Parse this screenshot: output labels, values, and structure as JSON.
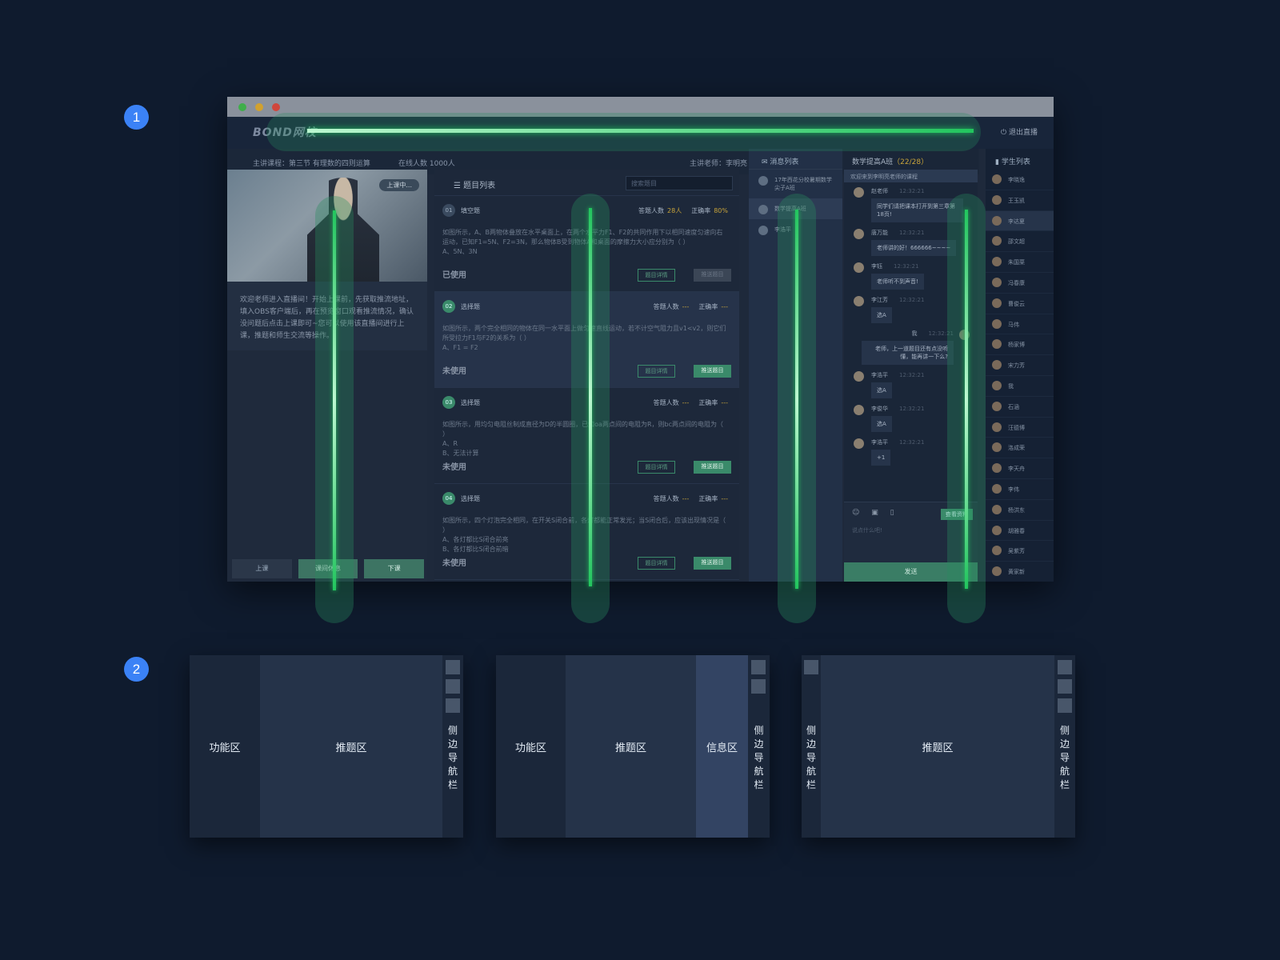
{
  "badges": [
    "1",
    "2"
  ],
  "app": {
    "logo": "BOND网校",
    "exit": "退出直播",
    "course": "主讲课程：第三节 有理数的四则运算",
    "online": "在线人数  1000人",
    "teacher": "主讲老师：李明亮"
  },
  "left": {
    "live": "上课中...",
    "welcome": "欢迎老师进入直播间！开始上课前，先获取推流地址，填入OBS客户端后，再在预览窗口观看推流情况，确认没问题后点击上课即可~您可以使用该直播间进行上课，推题和师生交流等操作。",
    "buttons": [
      "上课",
      "课间休息",
      "下课"
    ]
  },
  "qlist": {
    "title": "题目列表",
    "search_placeholder": "搜索题目",
    "questions": [
      {
        "num": "01",
        "type": "填空题",
        "answered_label": "答题人数",
        "answered": "28人",
        "rate_label": "正确率",
        "rate": "80%",
        "body": "如图所示，A、B两物体叠放在水平桌面上，在两个水平力F1、F2的共同作用下以相同速度匀速向右运动，已知F1=5N、F2=3N，那么物体B受到物体A和桌面的摩擦力大小应分别为（    ）",
        "opts": [
          "A、5N、3N"
        ],
        "state": "已使用",
        "detail": "题目详情",
        "push": "推送题目"
      },
      {
        "num": "02",
        "type": "选择题",
        "answered_label": "答题人数",
        "answered": "---",
        "rate_label": "正确率",
        "rate": "---",
        "body": "如图所示，两个完全相同的物体在同一水平面上做匀速直线运动，若不计空气阻力且v1<v2，则它们所受拉力F1与F2的关系为（    ）",
        "opts": [
          "A、F1 = F2"
        ],
        "state": "未使用",
        "detail": "题目详情",
        "push": "推送题目"
      },
      {
        "num": "03",
        "type": "选择题",
        "answered_label": "答题人数",
        "answered": "---",
        "rate_label": "正确率",
        "rate": "---",
        "body": "如图所示，用均匀电阻丝制成直径为D的半圆圈，已知oa两点间的电阻为R，则bc两点间的电阻为（    ）",
        "opts": [
          "A、R",
          "B、无法计算"
        ],
        "state": "未使用",
        "detail": "题目详情",
        "push": "推送题目"
      },
      {
        "num": "04",
        "type": "选择题",
        "answered_label": "答题人数",
        "answered": "---",
        "rate_label": "正确率",
        "rate": "---",
        "body": "如图所示，四个灯泡完全相同，在开关S闭合前，各灯都能正常发光；当S闭合后，应该出现情况是（    ）",
        "opts": [
          "A、各灯都比S闭合前亮",
          "B、各灯都比S闭合前暗"
        ],
        "state": "未使用",
        "detail": "题目详情",
        "push": "推送题目"
      }
    ]
  },
  "messages": {
    "title": "消息列表",
    "items": [
      "17年西花分校暑期数学尖子A班",
      "数学提高A班",
      "李浩平"
    ]
  },
  "chat": {
    "title": "数学提高A班",
    "count": "（22/28）",
    "notice": "欢迎来到李明亮老师的课程",
    "entries": [
      {
        "name": "赵老师",
        "time": "12:32:21",
        "text": "同学们请把课本打开到第三章第18页!"
      },
      {
        "name": "唐万能",
        "time": "12:32:21",
        "text": "老师讲的好！666666~~~~"
      },
      {
        "name": "李钰",
        "time": "12:32:21",
        "text": "老师听不到声音!"
      },
      {
        "name": "李江芳",
        "time": "12:32:21",
        "text": "选A"
      },
      {
        "name": "我",
        "time": "12:32:21",
        "text": "老师，上一道题目还有点没听懂，能再讲一下么?"
      },
      {
        "name": "李浩平",
        "time": "12:32:21",
        "text": "选A"
      },
      {
        "name": "李俊华",
        "time": "12:32:21",
        "text": "选A"
      },
      {
        "name": "李浩平",
        "time": "12:32:21",
        "text": "+1"
      }
    ],
    "tools": "☺ ▣ ▯",
    "view_profile": "查看资料",
    "placeholder": "说点什么吧!",
    "send": "发送"
  },
  "students": {
    "title": "学生列表",
    "items": [
      "李晓逸",
      "王玉凯",
      "李达夏",
      "邵文超",
      "朱国栗",
      "冯春康",
      "曹俊云",
      "马伟",
      "杨家博",
      "宋力芳",
      "我",
      "石涵",
      "汪德博",
      "洛成荣",
      "李天舟",
      "李伟",
      "杨洪东",
      "胡雅春",
      "吴紫芳",
      "黄家新"
    ]
  },
  "diagrams": [
    {
      "zones": [
        "功能区",
        "推题区"
      ],
      "nav": "侧边导航栏"
    },
    {
      "zones": [
        "功能区",
        "推题区",
        "信息区"
      ],
      "nav": "侧边导航栏"
    },
    {
      "left_nav": "侧边导航栏",
      "zones": [
        "推题区"
      ],
      "nav": "侧边导航栏"
    }
  ],
  "colors": {
    "accent": "#22c55e",
    "badge": "#3b82f6",
    "background": "#0f1b2e"
  }
}
